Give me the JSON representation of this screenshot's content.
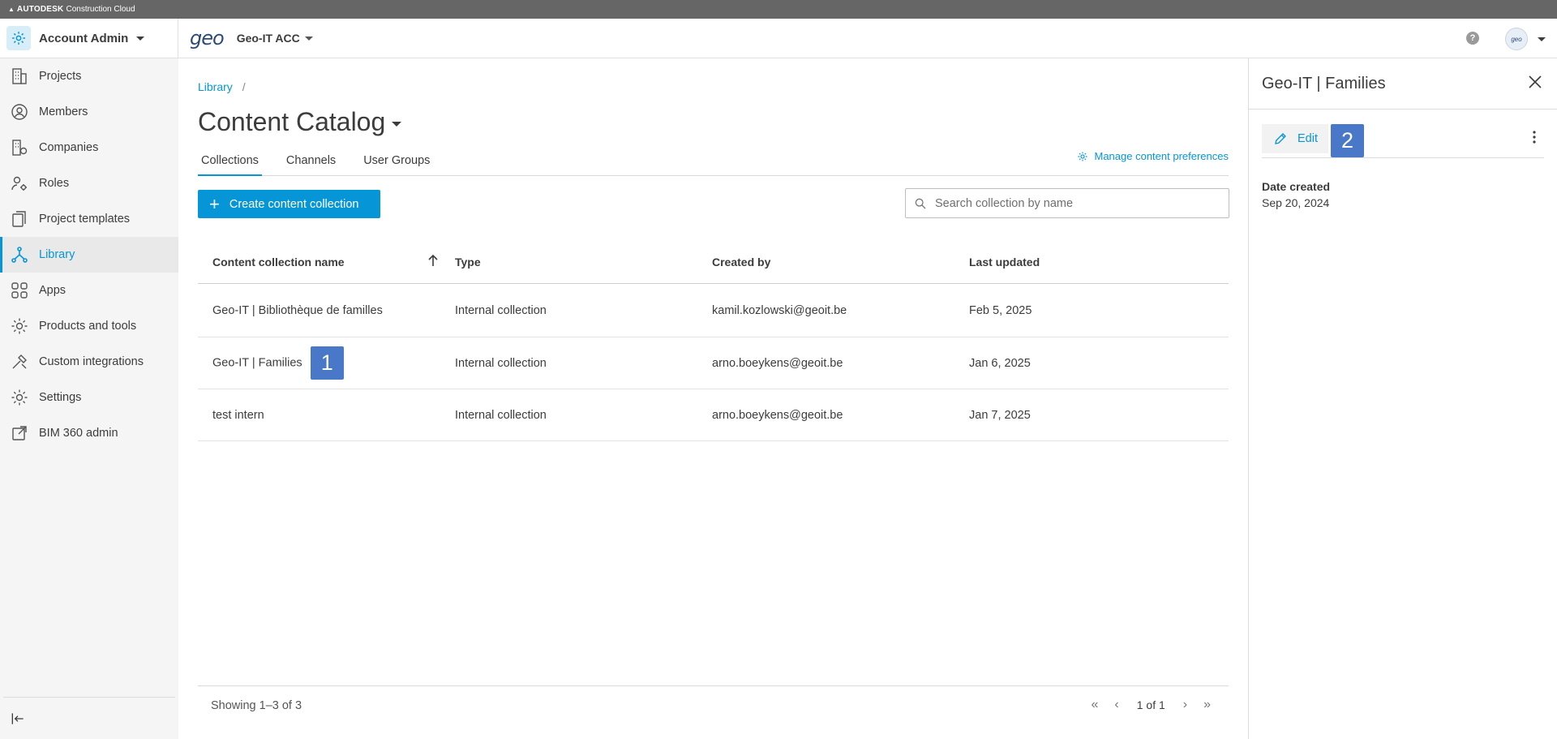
{
  "topbar": {
    "brand": "AUTODESK",
    "product": "Construction Cloud"
  },
  "header": {
    "account_label": "Account Admin",
    "logo_text": "geo",
    "project_name": "Geo-IT ACC",
    "help_label": "?",
    "avatar_text": "geo"
  },
  "sidebar": {
    "items": [
      {
        "label": "Projects",
        "icon": "building-icon"
      },
      {
        "label": "Members",
        "icon": "person-circle-icon"
      },
      {
        "label": "Companies",
        "icon": "companies-icon"
      },
      {
        "label": "Roles",
        "icon": "person-gear-icon"
      },
      {
        "label": "Project templates",
        "icon": "template-icon"
      },
      {
        "label": "Library",
        "icon": "library-icon"
      },
      {
        "label": "Apps",
        "icon": "apps-grid-icon"
      },
      {
        "label": "Products and tools",
        "icon": "gear-icon"
      },
      {
        "label": "Custom integrations",
        "icon": "tools-icon"
      },
      {
        "label": "Settings",
        "icon": "gear-icon"
      },
      {
        "label": "BIM 360 admin",
        "icon": "external-link-icon"
      }
    ],
    "active_index": 5
  },
  "main": {
    "breadcrumb": {
      "root": "Library",
      "sep": "/"
    },
    "title": "Content Catalog",
    "tabs": [
      {
        "label": "Collections"
      },
      {
        "label": "Channels"
      },
      {
        "label": "User Groups"
      }
    ],
    "manage_link": "Manage content preferences",
    "create_button": "Create content collection",
    "search_placeholder": "Search collection by name",
    "table": {
      "columns": [
        "Content collection name",
        "Type",
        "Created by",
        "Last updated"
      ],
      "rows": [
        {
          "name": "Geo-IT | Bibliothèque de familles",
          "type": "Internal collection",
          "created_by": "kamil.kozlowski@geoit.be",
          "updated": "Feb 5, 2025"
        },
        {
          "name": "Geo-IT | Families",
          "type": "Internal collection",
          "created_by": "arno.boeykens@geoit.be",
          "updated": "Jan 6, 2025"
        },
        {
          "name": "test intern",
          "type": "Internal collection",
          "created_by": "arno.boeykens@geoit.be",
          "updated": "Jan 7, 2025"
        }
      ]
    },
    "showing": "Showing 1–3 of 3",
    "page_text": "1 of 1",
    "annotation_1": "1"
  },
  "panel": {
    "title": "Geo-IT | Families",
    "edit_label": "Edit",
    "annotation_2": "2",
    "date_created_label": "Date created",
    "date_created_value": "Sep 20, 2024"
  },
  "colors": {
    "accent": "#0696d7",
    "annotation": "#4a78c8"
  }
}
